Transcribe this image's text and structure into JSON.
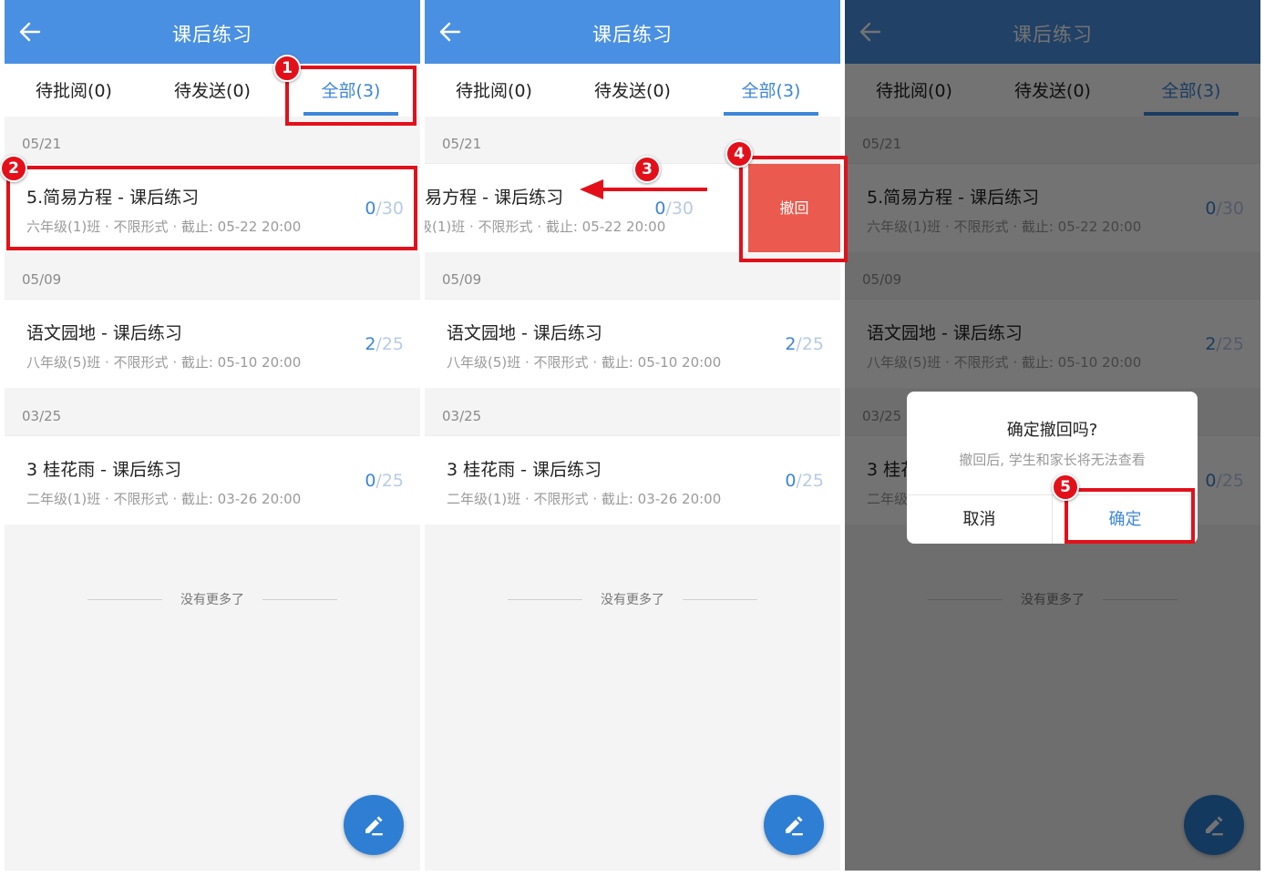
{
  "app": {
    "title": "课后练习"
  },
  "tabs": [
    {
      "label": "待批阅(0)"
    },
    {
      "label": "待发送(0)"
    },
    {
      "label": "全部(3)"
    }
  ],
  "sections": [
    {
      "date": "05/21",
      "title": "5.简易方程 - 课后练习",
      "meta": "六年级(1)班 · 不限形式 · 截止: 05-22 20:00",
      "done": "0",
      "total": "30"
    },
    {
      "date": "05/09",
      "title": "语文园地 - 课后练习",
      "meta": "八年级(5)班 · 不限形式 · 截止: 05-10 20:00",
      "done": "2",
      "total": "25"
    },
    {
      "date": "03/25",
      "title": "3 桂花雨 - 课后练习",
      "meta": "二年级(1)班 · 不限形式 · 截止: 03-26 20:00",
      "done": "0",
      "total": "25"
    }
  ],
  "no_more": "没有更多了",
  "swipe_action": {
    "label": "撤回"
  },
  "dialog": {
    "title": "确定撤回吗?",
    "message": "撤回后, 学生和家长将无法查看",
    "cancel": "取消",
    "confirm": "确定"
  },
  "steps": [
    "1",
    "2",
    "3",
    "4",
    "5"
  ],
  "colors": {
    "accent": "#4a90e2",
    "tab_active": "#3d86d8",
    "revoke": "#ea5a4f",
    "highlight": "#e3101a"
  },
  "icons": {
    "back": "arrow-left-icon",
    "fab": "pencil-edit-icon"
  }
}
